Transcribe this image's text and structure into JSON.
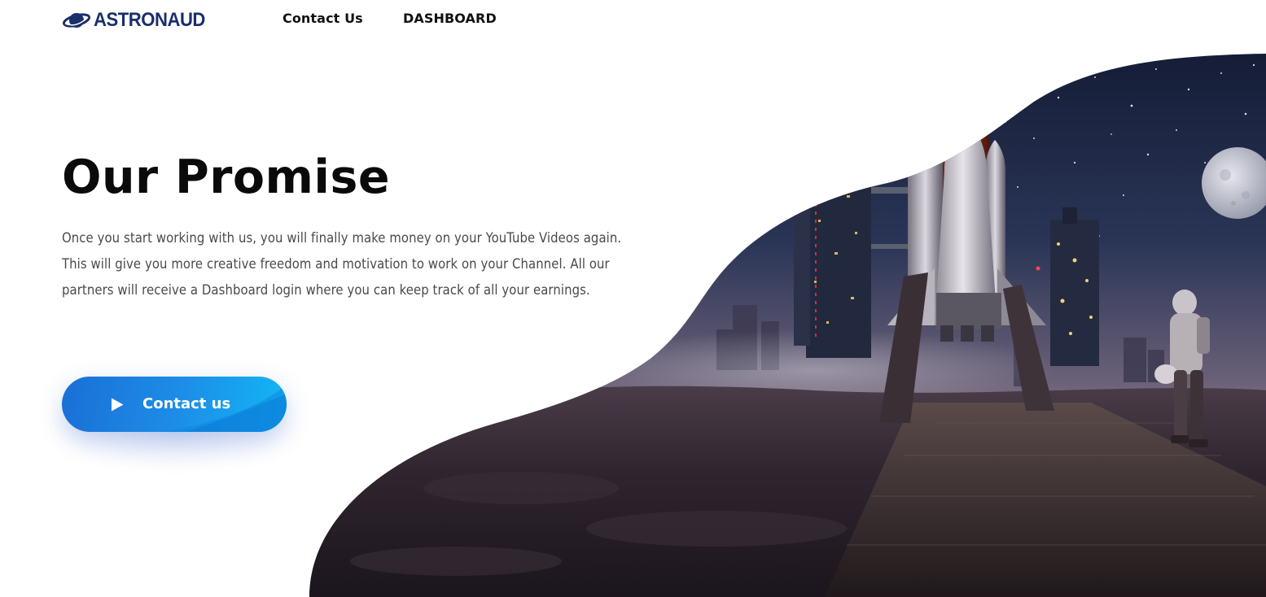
{
  "header": {
    "logo_text": "ASTRONAUD",
    "logo_icon": "planet-ring-icon",
    "nav": [
      {
        "label": "Contact Us"
      },
      {
        "label": "DASHBOARD"
      }
    ]
  },
  "hero": {
    "title": "Our Promise",
    "description": "Once you start working with us, you will finally make money on your YouTube Videos again. This will give you more creative freedom and motivation to work on your Channel. All our partners will receive a Dashboard login where you can keep track of all your earnings.",
    "cta": {
      "label": "Contact us",
      "icon": "play-icon"
    },
    "illustration": "space-shuttle-launch-pad-with-astronaut"
  },
  "colors": {
    "brand": "#1a2f6b",
    "cta_start": "#1a6fd6",
    "cta_end": "#12b8f5",
    "title": "#0a0a0a",
    "body_text": "#4a4a4a"
  }
}
